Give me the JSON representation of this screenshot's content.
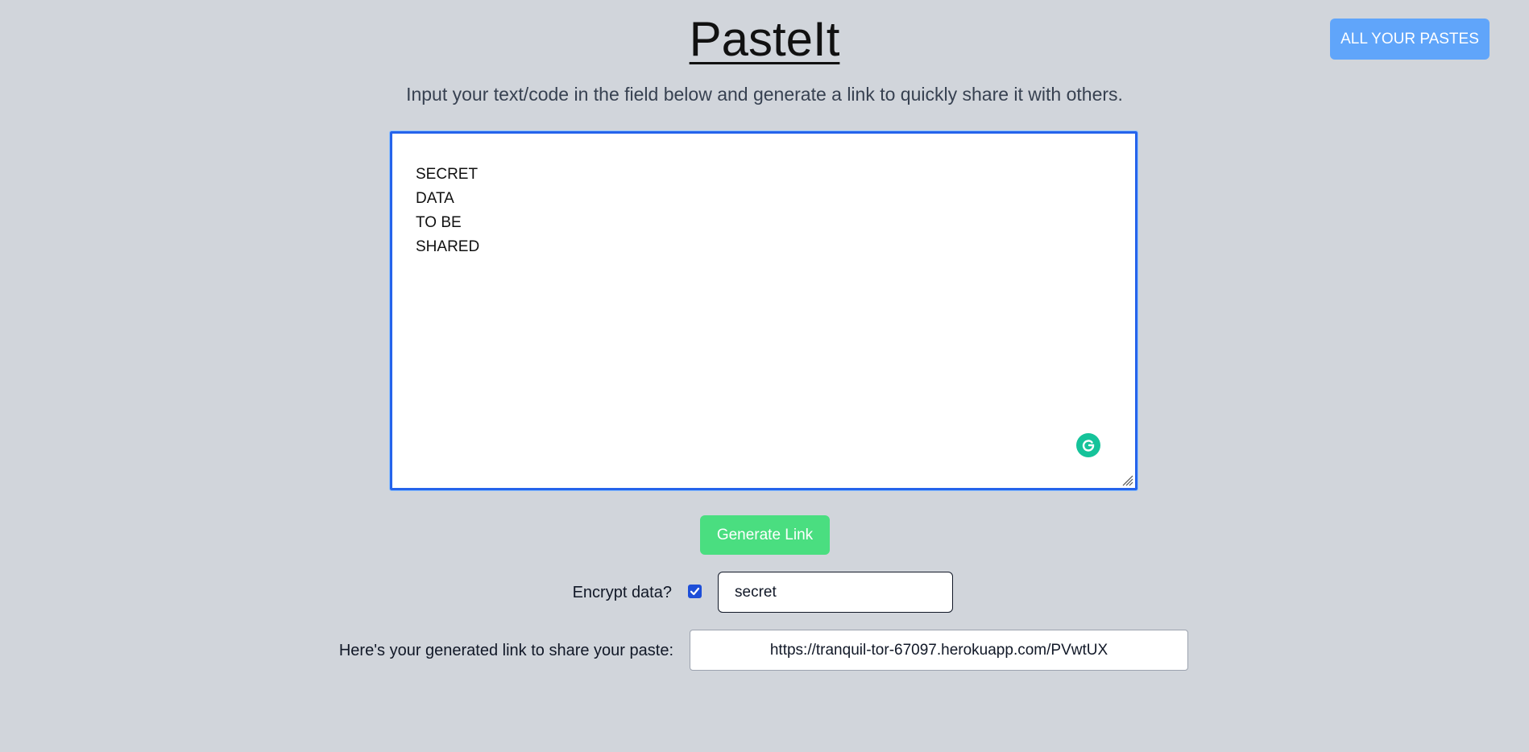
{
  "header": {
    "title": "PasteIt",
    "all_pastes_label": "ALL YOUR PASTES",
    "subtitle": "Input your text/code in the field below and generate a link to quickly share it with others."
  },
  "editor": {
    "content": "SECRET\nDATA\nTO BE\nSHARED",
    "assistant_icon": "grammarly-icon"
  },
  "actions": {
    "generate_label": "Generate Link"
  },
  "encrypt": {
    "label": "Encrypt data?",
    "checked": true,
    "password_value": "secret"
  },
  "result": {
    "label": "Here's your generated link to share your paste:",
    "link": "https://tranquil-tor-67097.herokuapp.com/PVwtUX"
  },
  "colors": {
    "background": "#d1d5db",
    "all_pastes_button": "#60a5fa",
    "generate_button": "#4ade80",
    "editor_focus_border": "#2563eb",
    "grammarly": "#15c39a"
  }
}
